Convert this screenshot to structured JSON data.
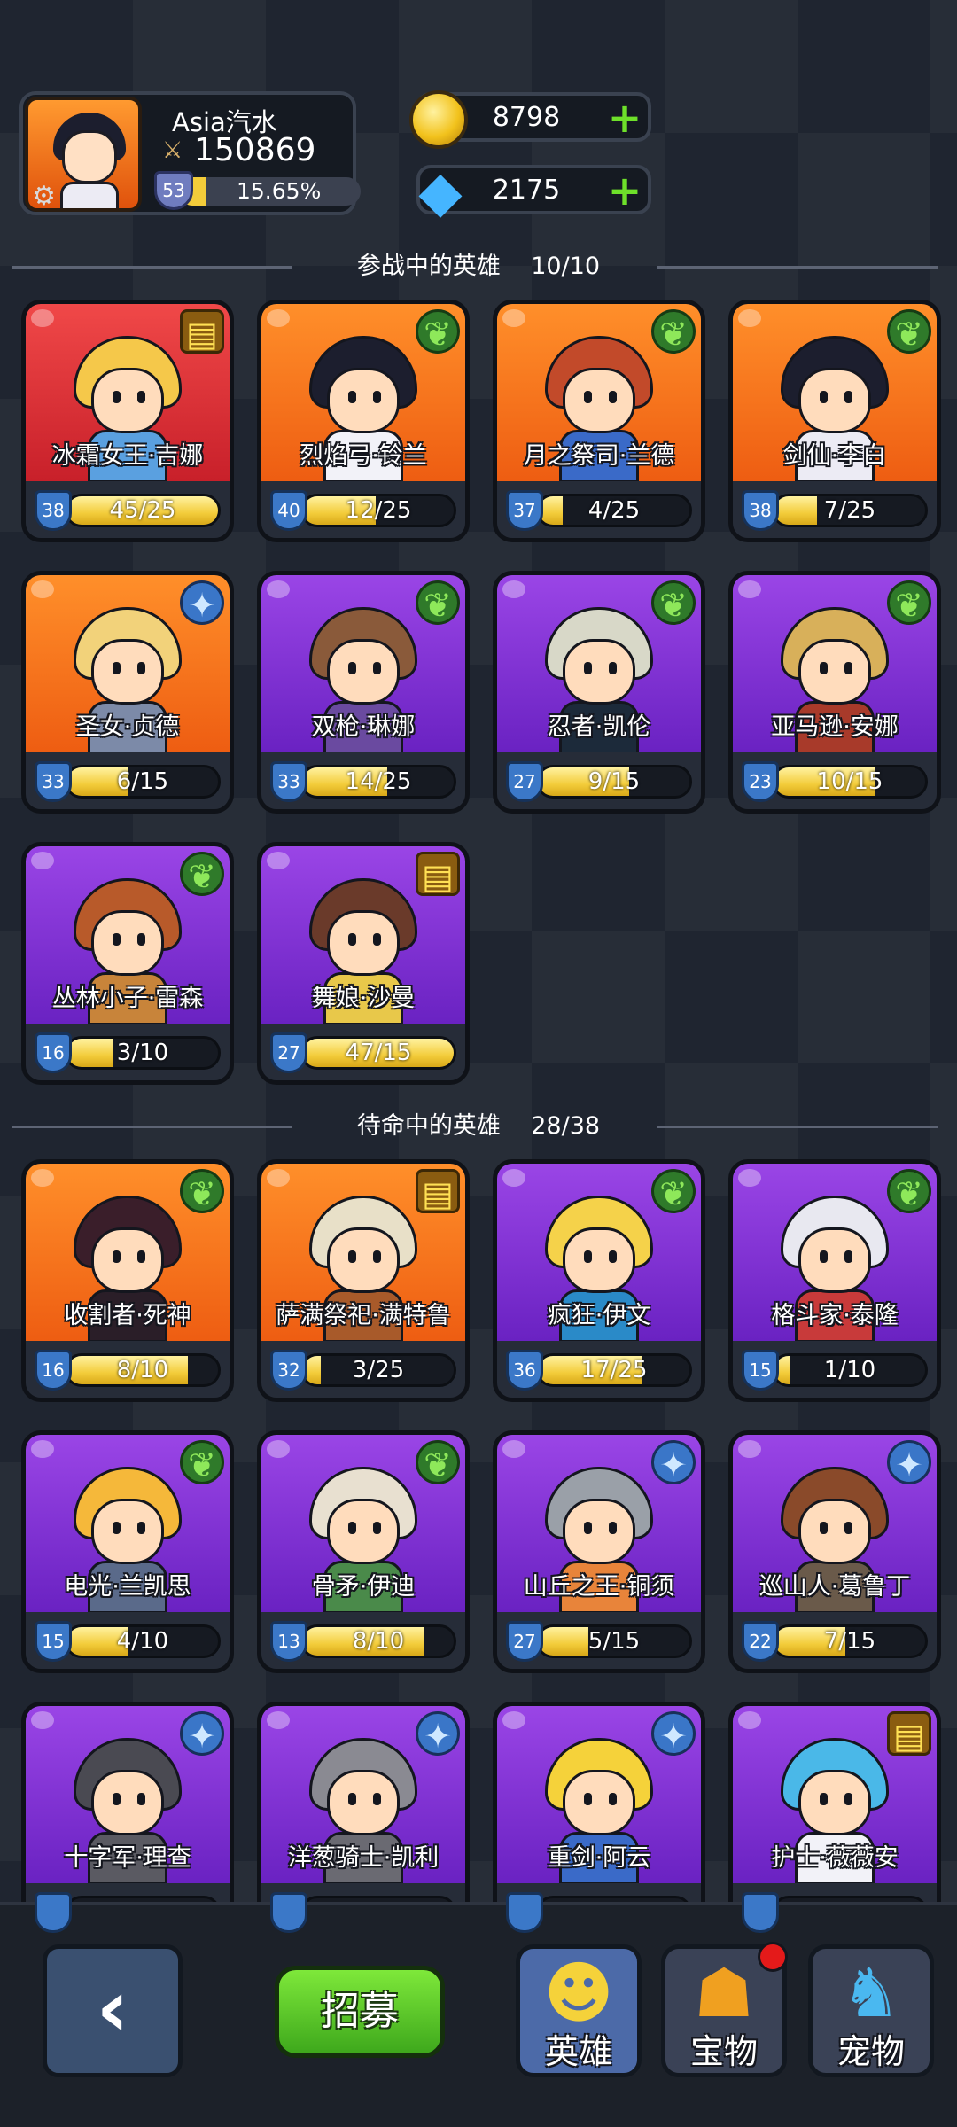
{
  "player": {
    "name": "Asia汽水",
    "power": "150869",
    "level": "53",
    "xp_percent_text": "15.65%",
    "xp_fraction": 0.1565
  },
  "resources": {
    "gold": "8798",
    "gems": "2175"
  },
  "sections": {
    "active_title": "参战中的英雄    10/10",
    "standby_title": "待命中的英雄    28/38"
  },
  "active_heroes": [
    {
      "name": "冰霜女王·吉娜",
      "level": "38",
      "shards": "45/25",
      "fill": 1.0,
      "bg": "red",
      "class_icon": "book",
      "hair": "#f5c84a",
      "torso": "#5aa0e0"
    },
    {
      "name": "烈焰弓·铃兰",
      "level": "40",
      "shards": "12/25",
      "fill": 0.48,
      "bg": "orange",
      "class_icon": "wing",
      "hair": "#1c1e2e",
      "torso": "#f2f2f8"
    },
    {
      "name": "月之祭司·兰德",
      "level": "37",
      "shards": "4/25",
      "fill": 0.16,
      "bg": "orange",
      "class_icon": "wing",
      "hair": "#c24a2a",
      "torso": "#3a6ac8"
    },
    {
      "name": "剑仙·李白",
      "level": "38",
      "shards": "7/25",
      "fill": 0.28,
      "bg": "orange",
      "class_icon": "wing",
      "hair": "#1c1e2e",
      "torso": "#ecebf4"
    },
    {
      "name": "圣女·贞德",
      "level": "33",
      "shards": "6/15",
      "fill": 0.4,
      "bg": "orange",
      "class_icon": "sword",
      "hair": "#f2d27a",
      "torso": "#7c8aa8"
    },
    {
      "name": "双枪·琳娜",
      "level": "33",
      "shards": "14/25",
      "fill": 0.56,
      "bg": "purple",
      "class_icon": "wing",
      "hair": "#8a5a3a",
      "torso": "#6a4aa0"
    },
    {
      "name": "忍者·凯伦",
      "level": "27",
      "shards": "9/15",
      "fill": 0.6,
      "bg": "purple",
      "class_icon": "wing",
      "hair": "#d8d8c8",
      "torso": "#1c2a3a"
    },
    {
      "name": "亚马逊·安娜",
      "level": "23",
      "shards": "10/15",
      "fill": 0.67,
      "bg": "purple",
      "class_icon": "wing",
      "hair": "#d8b05a",
      "torso": "#a83a2a"
    },
    {
      "name": "丛林小子·雷森",
      "level": "16",
      "shards": "3/10",
      "fill": 0.3,
      "bg": "purple",
      "class_icon": "wing",
      "hair": "#b85a2a",
      "torso": "#c8843a"
    },
    {
      "name": "舞娘·沙曼",
      "level": "27",
      "shards": "47/15",
      "fill": 1.0,
      "bg": "purple",
      "class_icon": "book",
      "hair": "#6a3a2a",
      "torso": "#e8c84a"
    }
  ],
  "standby_heroes": [
    {
      "name": "收割者·死神",
      "level": "16",
      "shards": "8/10",
      "fill": 0.8,
      "bg": "orange",
      "class_icon": "wing",
      "hair": "#3a1e2a",
      "torso": "#2a1e28"
    },
    {
      "name": "萨满祭祀·满特鲁",
      "level": "32",
      "shards": "3/25",
      "fill": 0.12,
      "bg": "orange",
      "class_icon": "book",
      "hair": "#e8e0c8",
      "torso": "#a85a2a"
    },
    {
      "name": "疯狂·伊文",
      "level": "36",
      "shards": "17/25",
      "fill": 0.68,
      "bg": "purple",
      "class_icon": "wing",
      "hair": "#f5d24a",
      "torso": "#2a8ac8"
    },
    {
      "name": "格斗家·泰隆",
      "level": "15",
      "shards": "1/10",
      "fill": 0.1,
      "bg": "purple",
      "class_icon": "wing",
      "hair": "#e8e8f0",
      "torso": "#c83a3a"
    },
    {
      "name": "电光·兰凯思",
      "level": "15",
      "shards": "4/10",
      "fill": 0.4,
      "bg": "purple",
      "class_icon": "wing",
      "hair": "#f5b83a",
      "torso": "#5a6a8a"
    },
    {
      "name": "骨矛·伊迪",
      "level": "13",
      "shards": "8/10",
      "fill": 0.8,
      "bg": "purple",
      "class_icon": "wing",
      "hair": "#e8e0d0",
      "torso": "#4a8a4a"
    },
    {
      "name": "山丘之王·铜须",
      "level": "27",
      "shards": "5/15",
      "fill": 0.33,
      "bg": "purple",
      "class_icon": "sword",
      "hair": "#9aa0a8",
      "torso": "#e8843a"
    },
    {
      "name": "巡山人·葛鲁丁",
      "level": "22",
      "shards": "7/15",
      "fill": 0.47,
      "bg": "purple",
      "class_icon": "sword",
      "hair": "#8a4a2a",
      "torso": "#6a5a4a"
    },
    {
      "name": "十字军·理查",
      "level": "",
      "shards": "",
      "fill": 0,
      "bg": "purple",
      "class_icon": "sword",
      "hair": "#4a4a52",
      "torso": "#5a5a62"
    },
    {
      "name": "洋葱骑士·凯利",
      "level": "",
      "shards": "",
      "fill": 0,
      "bg": "purple",
      "class_icon": "sword",
      "hair": "#8a8a92",
      "torso": "#6a6a72"
    },
    {
      "name": "重剑·阿云",
      "level": "",
      "shards": "",
      "fill": 0,
      "bg": "purple",
      "class_icon": "sword",
      "hair": "#f5d23a",
      "torso": "#3a6ac8"
    },
    {
      "name": "护士·薇薇安",
      "level": "",
      "shards": "",
      "fill": 0,
      "bg": "purple",
      "class_icon": "book",
      "hair": "#4ab8e8",
      "torso": "#f2f2f8"
    }
  ],
  "nav": {
    "recruit_label": "招募",
    "tabs": [
      {
        "label": "英雄",
        "icon": "hero-head-icon",
        "active": true
      },
      {
        "label": "宝物",
        "icon": "tiki-mask-icon",
        "active": false,
        "notify": true
      },
      {
        "label": "宠物",
        "icon": "blue-beast-icon",
        "active": false
      }
    ]
  },
  "colors": {
    "shard_fill": "#f3cc3a",
    "recruit_green": "#5cc82a",
    "notify_red": "#e41a1a"
  }
}
